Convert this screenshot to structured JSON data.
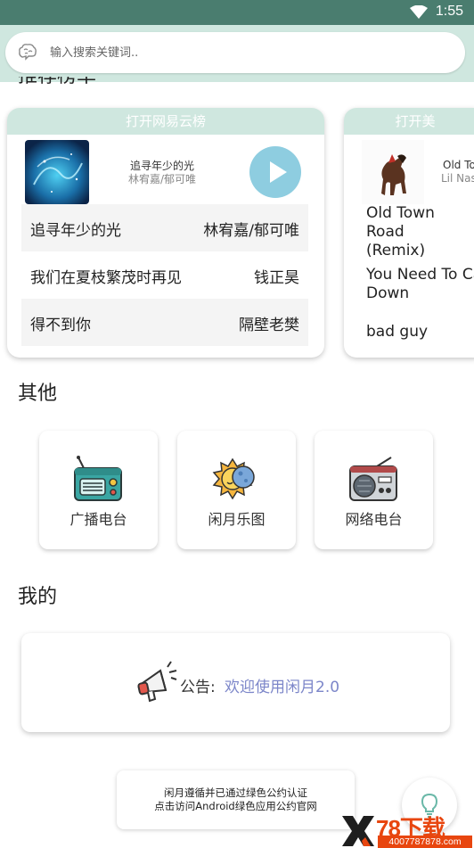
{
  "status_bar": {
    "time": "1:55"
  },
  "search": {
    "placeholder": "输入搜索关键词.."
  },
  "sections": {
    "charts_heading": "推荐榜单",
    "other_heading": "其他",
    "mine_heading": "我的"
  },
  "chart_cards": [
    {
      "header": "打开网易云榜",
      "featured": {
        "title": "追寻年少的光",
        "artist": "林宥嘉/郁可唯"
      },
      "songs": [
        {
          "title": "追寻年少的光",
          "artist": "林宥嘉/郁可唯"
        },
        {
          "title": "我们在夏枝繁茂时再见",
          "artist": "钱正昊"
        },
        {
          "title": "得不到你",
          "artist": "隔壁老樊"
        }
      ]
    },
    {
      "header": "打开美",
      "featured": {
        "title": "Old To",
        "artist": "Lil Nas"
      },
      "songs": [
        {
          "title": "Old Town Road (Remix)",
          "artist": "L"
        },
        {
          "title": "You Need To Ca Down",
          "artist": ""
        },
        {
          "title": "bad guy",
          "artist": ""
        }
      ]
    }
  ],
  "other_tiles": [
    {
      "label": "广播电台",
      "icon": "radio-icon"
    },
    {
      "label": "闲月乐图",
      "icon": "sun-moon-icon"
    },
    {
      "label": "网络电台",
      "icon": "retro-radio-icon"
    }
  ],
  "notice": {
    "label": "公告:",
    "text": "欢迎使用闲月2.0",
    "icon": "megaphone-icon"
  },
  "footer": {
    "line1": "闲月遵循并已通过绿色公约认证",
    "line2": "点击访问Android绿色应用公约官网"
  },
  "fab": {
    "icon": "lightbulb-icon"
  },
  "watermark": {
    "number": "78下载",
    "site": "4007787878.com"
  },
  "colors": {
    "status_bar": "#4a7d6f",
    "accent_light": "#cfe7df",
    "play": "#8ecde0",
    "notice_text": "#7c86c9",
    "watermark": "#e8460f"
  }
}
